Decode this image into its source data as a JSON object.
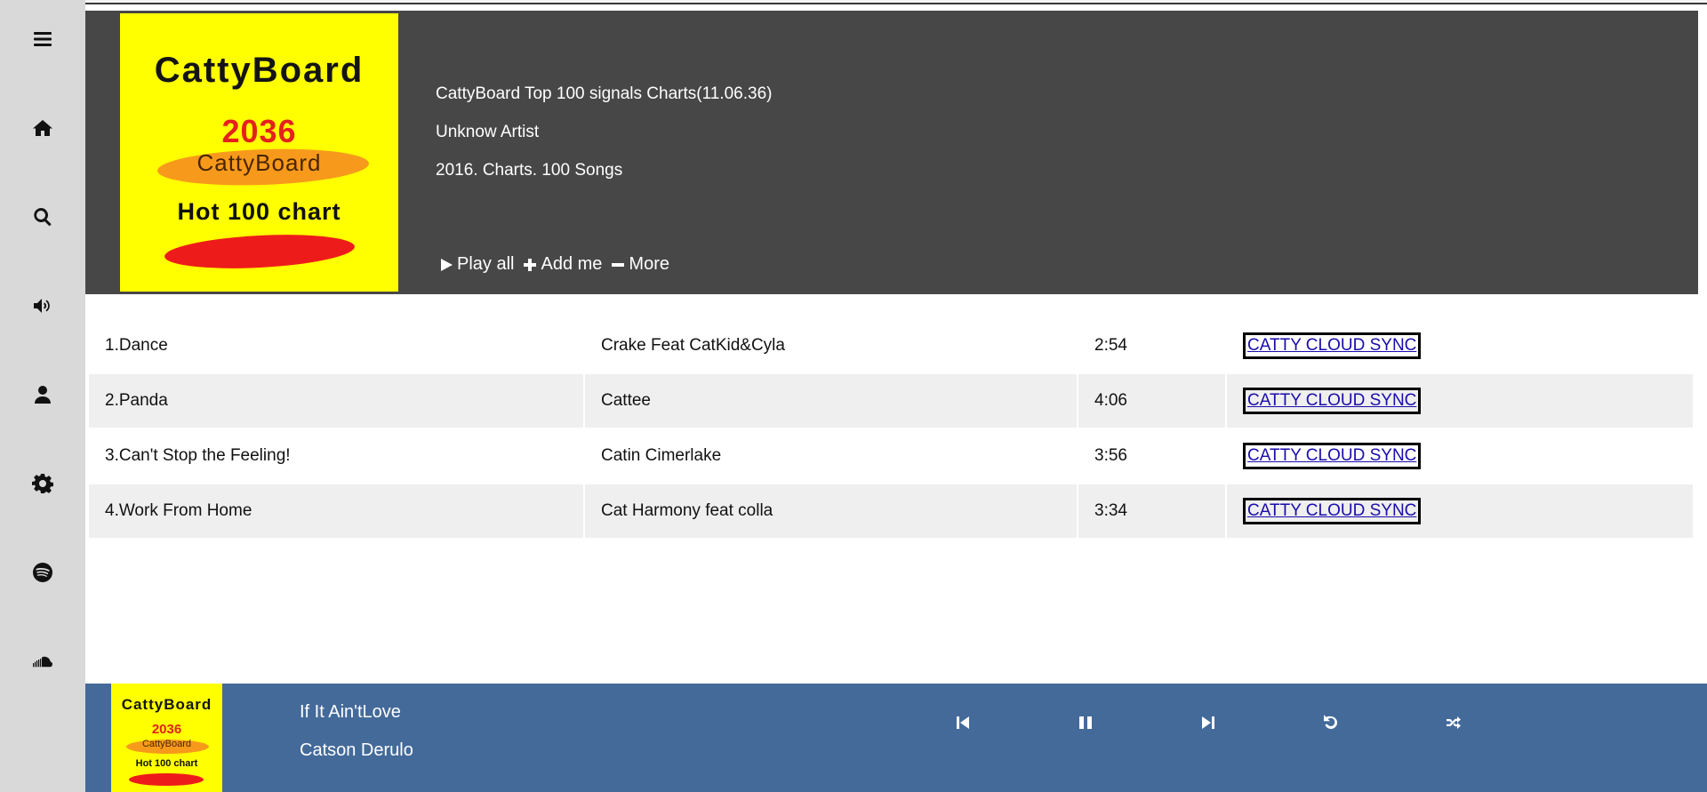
{
  "sidebar": {
    "items": [
      {
        "icon": "menu-icon"
      },
      {
        "icon": "home-icon"
      },
      {
        "icon": "search-icon"
      },
      {
        "icon": "volume-icon"
      },
      {
        "icon": "user-icon"
      },
      {
        "icon": "gear-icon"
      },
      {
        "icon": "spotify-icon"
      },
      {
        "icon": "soundcloud-icon"
      }
    ]
  },
  "header": {
    "cover": {
      "brand": "CattyBoard",
      "year": "2036",
      "sub": "CattyBoard",
      "hot": "Hot 100 chart"
    },
    "title": "CattyBoard Top 100 signals Charts(11.06.36)",
    "artist": "Unknow Artist",
    "meta": "2016. Charts. 100 Songs",
    "actions": {
      "play_all": "Play all",
      "add_me": "Add me",
      "more": "More"
    }
  },
  "tracks": [
    {
      "title": "1.Dance",
      "artist": "Crake Feat CatKid&Cyla",
      "duration": "2:54",
      "sync": "CATTY CLOUD SYNC"
    },
    {
      "title": "2.Panda",
      "artist": "Cattee",
      "duration": "4:06",
      "sync": "CATTY CLOUD SYNC"
    },
    {
      "title": "3.Can't Stop the Feeling!",
      "artist": "Catin Cimerlake",
      "duration": "3:56",
      "sync": "CATTY CLOUD SYNC"
    },
    {
      "title": "4.Work From Home",
      "artist": "Cat Harmony feat colla",
      "duration": "3:34",
      "sync": "CATTY CLOUD SYNC"
    }
  ],
  "player": {
    "cover": {
      "brand": "CattyBoard",
      "year": "2036",
      "sub": "CattyBoard",
      "hot": "Hot 100 chart"
    },
    "song": "If It Ain'tLove",
    "artist": "Catson Derulo",
    "controls": [
      "previous-icon",
      "pause-icon",
      "next-icon",
      "repeat-icon",
      "shuffle-icon"
    ]
  },
  "colors": {
    "sidebar_bg": "#d9d9d9",
    "header_bg": "#474747",
    "player_bg": "#446a9a",
    "row_alt_bg": "#efefef",
    "link": "#1a0dab"
  }
}
